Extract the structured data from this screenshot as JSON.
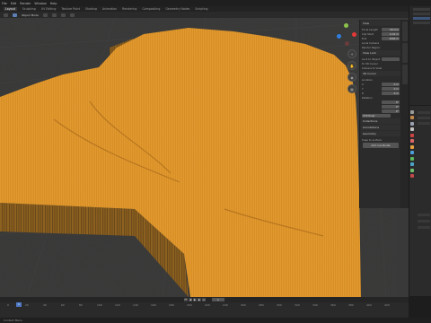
{
  "app": {
    "title": "Blender 4.1"
  },
  "menu": [
    "File",
    "Edit",
    "Render",
    "Window",
    "Help",
    "Layout",
    "Sculpting",
    "UV Editing",
    "Texture Paint",
    "Shading",
    "Animation",
    "Rendering",
    "Compositing",
    "Geometry Nodes",
    "Scripting"
  ],
  "workspace_tabs": [
    "Layout",
    "Sculpting",
    "UV Editing",
    "Texture Paint",
    "Shading",
    "Animation",
    "Rendering",
    "Compositing",
    "Geometry Nodes",
    "Scripting"
  ],
  "active_tab": "Layout",
  "viewport": {
    "mode": "Object Mode",
    "mesh_color": "#e59a2c",
    "grid_color": "#3f3f3f"
  },
  "npanel": {
    "view_title": "View",
    "focal_label": "Focal Length",
    "focal_value": "50 mm",
    "clip_start_label": "Clip Start",
    "clip_start_value": "0.01 m",
    "clip_end_label": "End",
    "clip_end_value": "1000 m",
    "local_camera_label": "Local Camera",
    "render_region_label": "Render Region",
    "view_lock_title": "View Lock",
    "lock_label": "Lock to Object",
    "lock_cursor_label": "To 3D Cursor",
    "lock_camera_label": "Camera to View",
    "cursor_title": "3D Cursor",
    "location_label": "Location",
    "x_label": "X",
    "x_value": "0 m",
    "y_label": "Y",
    "y_value": "0 m",
    "z_label": "Z",
    "z_value": "0 m",
    "rotation_label": "Rotation",
    "rx_value": "0°",
    "ry_value": "0°",
    "rz_value": "0°",
    "mode_label": "XYZ Euler",
    "collections_title": "Collections",
    "annotations_title": "Annotations",
    "geometry_title": "Geometry",
    "snap_label": "Snap to surface",
    "add_button": "Add coordinate"
  },
  "timeline": {
    "frame": "1",
    "ticks": [
      "0",
      "20",
      "40",
      "60",
      "80",
      "100",
      "120",
      "140",
      "160",
      "180",
      "200",
      "220",
      "240",
      "260",
      "280",
      "300",
      "320",
      "340",
      "360",
      "380",
      "400",
      "420"
    ]
  },
  "status": {
    "text": "Context Menu"
  }
}
